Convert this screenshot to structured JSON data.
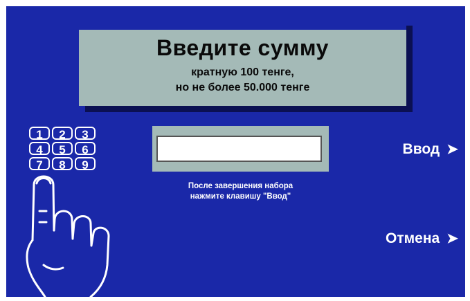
{
  "banner": {
    "title": "Введите сумму",
    "line1": "кратную 100 тенге,",
    "line2": "но не более 50.000 тенге"
  },
  "keypad": {
    "keys": [
      "1",
      "2",
      "3",
      "4",
      "5",
      "6",
      "7",
      "8",
      "9"
    ]
  },
  "hint": {
    "line1": "После завершения набора",
    "line2": "нажмите клавишу \"Ввод\""
  },
  "buttons": {
    "enter_label": "Ввод",
    "cancel_label": "Отмена",
    "arrow": "➤"
  },
  "colors": {
    "screen_bg": "#1a28a8",
    "panel_bg": "#a4bab7",
    "text_light": "#ffffff"
  },
  "icons": {
    "keypad_hand": "pointing-hand-icon",
    "arrows": "arrow-right-icon"
  }
}
